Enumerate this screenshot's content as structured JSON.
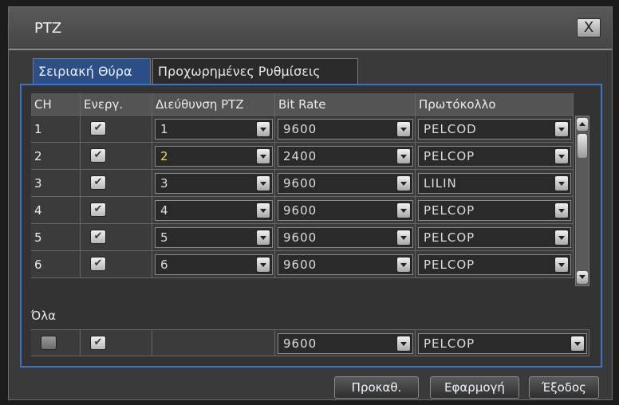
{
  "window": {
    "title": "PTZ",
    "close_label": "X"
  },
  "tabs": [
    {
      "label": "Σειριακή Θύρα",
      "active": true
    },
    {
      "label": "Προχωρημένες Ρυθμίσεις",
      "active": false
    }
  ],
  "table": {
    "headers": {
      "ch": "CH",
      "enabled": "Ενεργ.",
      "address": "Διεύθυνση PTZ",
      "bitrate": "Bit Rate",
      "protocol": "Πρωτόκολλο"
    },
    "rows": [
      {
        "ch": "1",
        "enabled": true,
        "address": "1",
        "bitrate": "9600",
        "protocol": "PELCOD"
      },
      {
        "ch": "2",
        "enabled": true,
        "address": "2",
        "bitrate": "2400",
        "protocol": "PELCOP"
      },
      {
        "ch": "3",
        "enabled": true,
        "address": "3",
        "bitrate": "9600",
        "protocol": "LILIN"
      },
      {
        "ch": "4",
        "enabled": true,
        "address": "4",
        "bitrate": "9600",
        "protocol": "PELCOP"
      },
      {
        "ch": "5",
        "enabled": true,
        "address": "5",
        "bitrate": "9600",
        "protocol": "PELCOP"
      },
      {
        "ch": "6",
        "enabled": true,
        "address": "6",
        "bitrate": "9600",
        "protocol": "PELCOP"
      }
    ]
  },
  "all": {
    "label": "Όλα",
    "select_checked": false,
    "enabled": true,
    "bitrate": "9600",
    "protocol": "PELCOP"
  },
  "buttons": {
    "default": "Προκαθ.",
    "apply": "Εφαρμογή",
    "exit": "Έξοδος"
  },
  "colors": {
    "accent": "#3c73c6",
    "active_tab": "#2b4f86",
    "highlight_text": "#e7d96a"
  }
}
